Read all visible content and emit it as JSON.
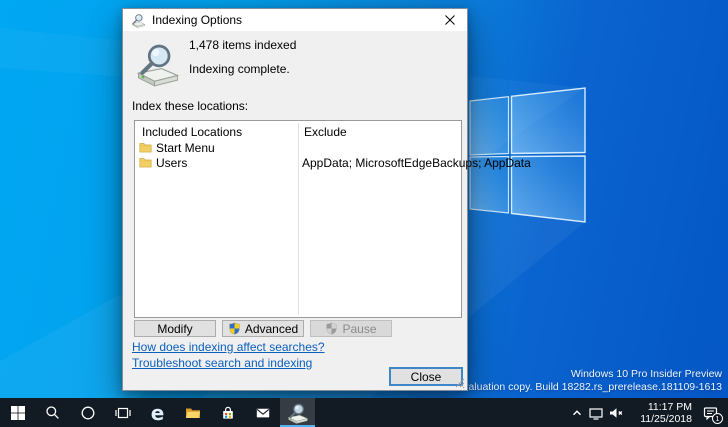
{
  "colors": {
    "accent": "#0078d7",
    "link_blue": "#0b5fbd",
    "taskbar_bg": "#121a23",
    "desktop_left": "#00a7f2",
    "desktop_right": "#0456c5"
  },
  "dialog": {
    "title": "Indexing Options",
    "items_indexed": "1,478 items indexed",
    "status_text": "Indexing complete.",
    "locations_label": "Index these locations:",
    "list": {
      "columns": {
        "included": "Included Locations",
        "exclude": "Exclude"
      },
      "rows": [
        {
          "name": "Start Menu",
          "exclude": ""
        },
        {
          "name": "Users",
          "exclude": "AppData; MicrosoftEdgeBackups; AppData"
        }
      ]
    },
    "buttons": {
      "modify": "Modify",
      "advanced": "Advanced",
      "pause": "Pause",
      "close": "Close"
    },
    "links": {
      "how": "How does indexing affect searches?",
      "troubleshoot": "Troubleshoot search and indexing"
    }
  },
  "desktop": {
    "watermark_line1": "Windows 10 Pro Insider Preview",
    "watermark_line2": "Evaluation copy. Build 18282.rs_prerelease.181109-1613"
  },
  "taskbar": {
    "items": [
      "start",
      "search",
      "cortana",
      "task-view",
      "edge",
      "file-explorer",
      "store",
      "mail",
      "indexing-options"
    ],
    "edge_glyph": "e",
    "tray": {
      "time": "11:17 PM",
      "date": "11/25/2018",
      "notification_count": "1"
    }
  }
}
